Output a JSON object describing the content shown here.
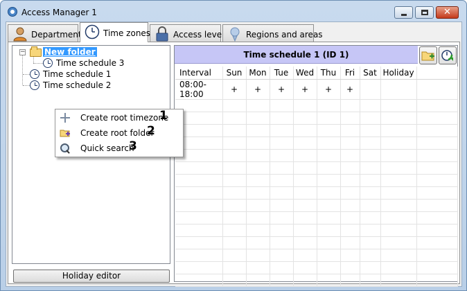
{
  "window": {
    "title": "Access Manager 1"
  },
  "tabs": [
    {
      "label": "Departments",
      "icon": "person-icon"
    },
    {
      "label": "Time zones",
      "icon": "clock-icon",
      "active": true
    },
    {
      "label": "Access levels",
      "icon": "lock-icon"
    },
    {
      "label": "Regions and areas",
      "icon": "pin-icon"
    }
  ],
  "tree": {
    "folder": "New folder",
    "folder_child": "Time schedule 3",
    "items": [
      "Time schedule 1",
      "Time schedule 2"
    ]
  },
  "holiday_button": "Holiday editor",
  "schedule": {
    "title": "Time schedule 1 (ID 1)",
    "columns": [
      "Interval",
      "Sun",
      "Mon",
      "Tue",
      "Wed",
      "Thu",
      "Fri",
      "Sat",
      "Holiday"
    ],
    "rows": [
      [
        "08:00-18:00",
        "+",
        "+",
        "+",
        "+",
        "+",
        "+",
        "",
        ""
      ]
    ]
  },
  "context_menu": [
    {
      "label": "Create root timezone",
      "number": "1",
      "icon": "plus-icon"
    },
    {
      "label": "Create root folder",
      "number": "2",
      "icon": "folder-add-icon"
    },
    {
      "label": "Quick search",
      "number": "3",
      "icon": "magnifier-icon"
    }
  ],
  "colors": {
    "header_bg": "#c6c6f6",
    "selection": "#3399ff",
    "title_bar": "#c8daee"
  }
}
